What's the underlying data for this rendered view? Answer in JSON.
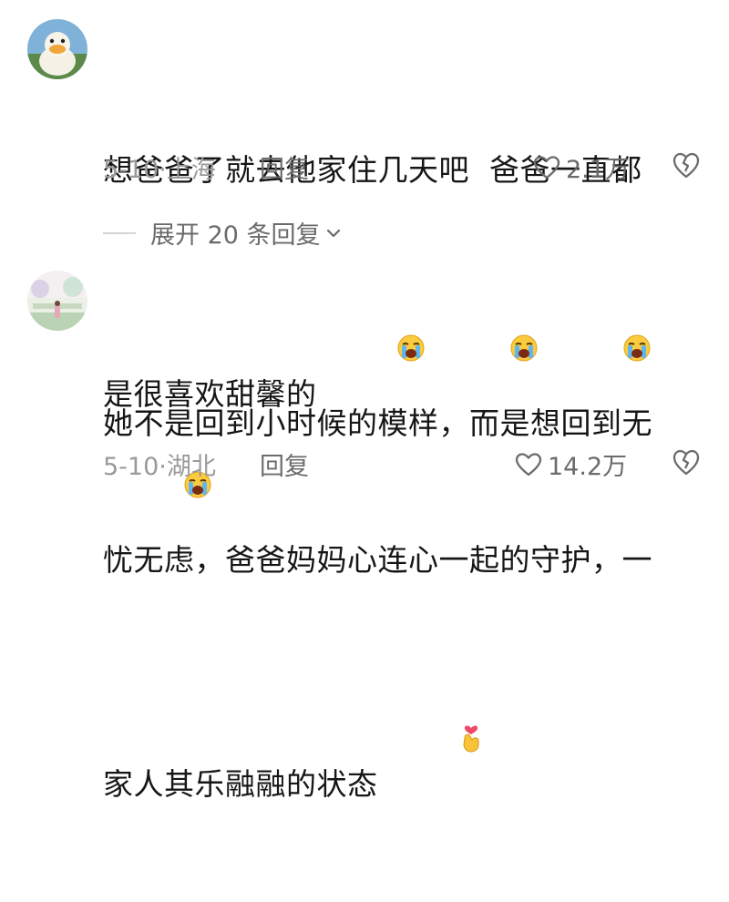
{
  "comments": [
    {
      "text_line1": "想爸爸了就去他家住几天吧  爸爸一直都",
      "text_line2": "是很喜欢甜馨的",
      "emojis": [
        "loudly-crying-face",
        "loudly-crying-face",
        "loudly-crying-face",
        "loudly-crying-face"
      ],
      "date": "5-10",
      "location": "上海",
      "reply_label": "回复",
      "likes": "2.1万",
      "expand_label": "展开 20 条回复"
    },
    {
      "text_line1": "她不是回到小时候的模样，而是想回到无",
      "text_line2": "忧无虑，爸爸妈妈心连心一起的守护，一",
      "text_line3": "家人其乐融融的状态",
      "emojis": [
        "finger-heart"
      ],
      "date": "5-10",
      "location": "湖北",
      "reply_label": "回复",
      "likes": "14.2万"
    }
  ],
  "colors": {
    "text": "#161616",
    "meta": "#9a9a9a",
    "action": "#6b6b6b",
    "divider": "#d5d5d5"
  }
}
